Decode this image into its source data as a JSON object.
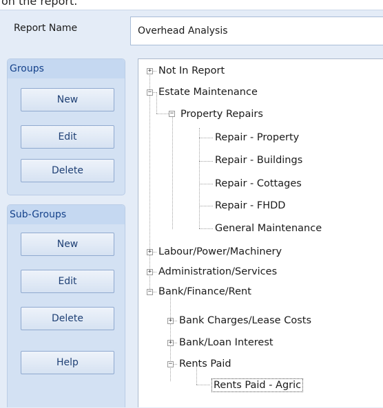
{
  "caption": "on the report.",
  "report_name": {
    "label": "Report Name",
    "value": "Overhead Analysis"
  },
  "groups": {
    "title": "Groups",
    "new_label": "New",
    "edit_label": "Edit",
    "delete_label": "Delete"
  },
  "subgroups": {
    "title": "Sub-Groups",
    "new_label": "New",
    "edit_label": "Edit",
    "delete_label": "Delete",
    "help_label": "Help"
  },
  "tree": {
    "n0": "Not In Report",
    "n1": "Estate Maintenance",
    "n2": "Property Repairs",
    "n3": "Repair - Property",
    "n4": "Repair - Buildings",
    "n5": "Repair - Cottages",
    "n6": "Repair - FHDD",
    "n7": "General Maintenance",
    "n8": "Labour/Power/Machinery",
    "n9": "Administration/Services",
    "n10": "Bank/Finance/Rent",
    "n11": "Bank Charges/Lease Costs",
    "n12": "Bank/Loan Interest",
    "n13": "Rents Paid",
    "n14": "Rents Paid - Agric",
    "plus": "+",
    "minus": "−"
  }
}
